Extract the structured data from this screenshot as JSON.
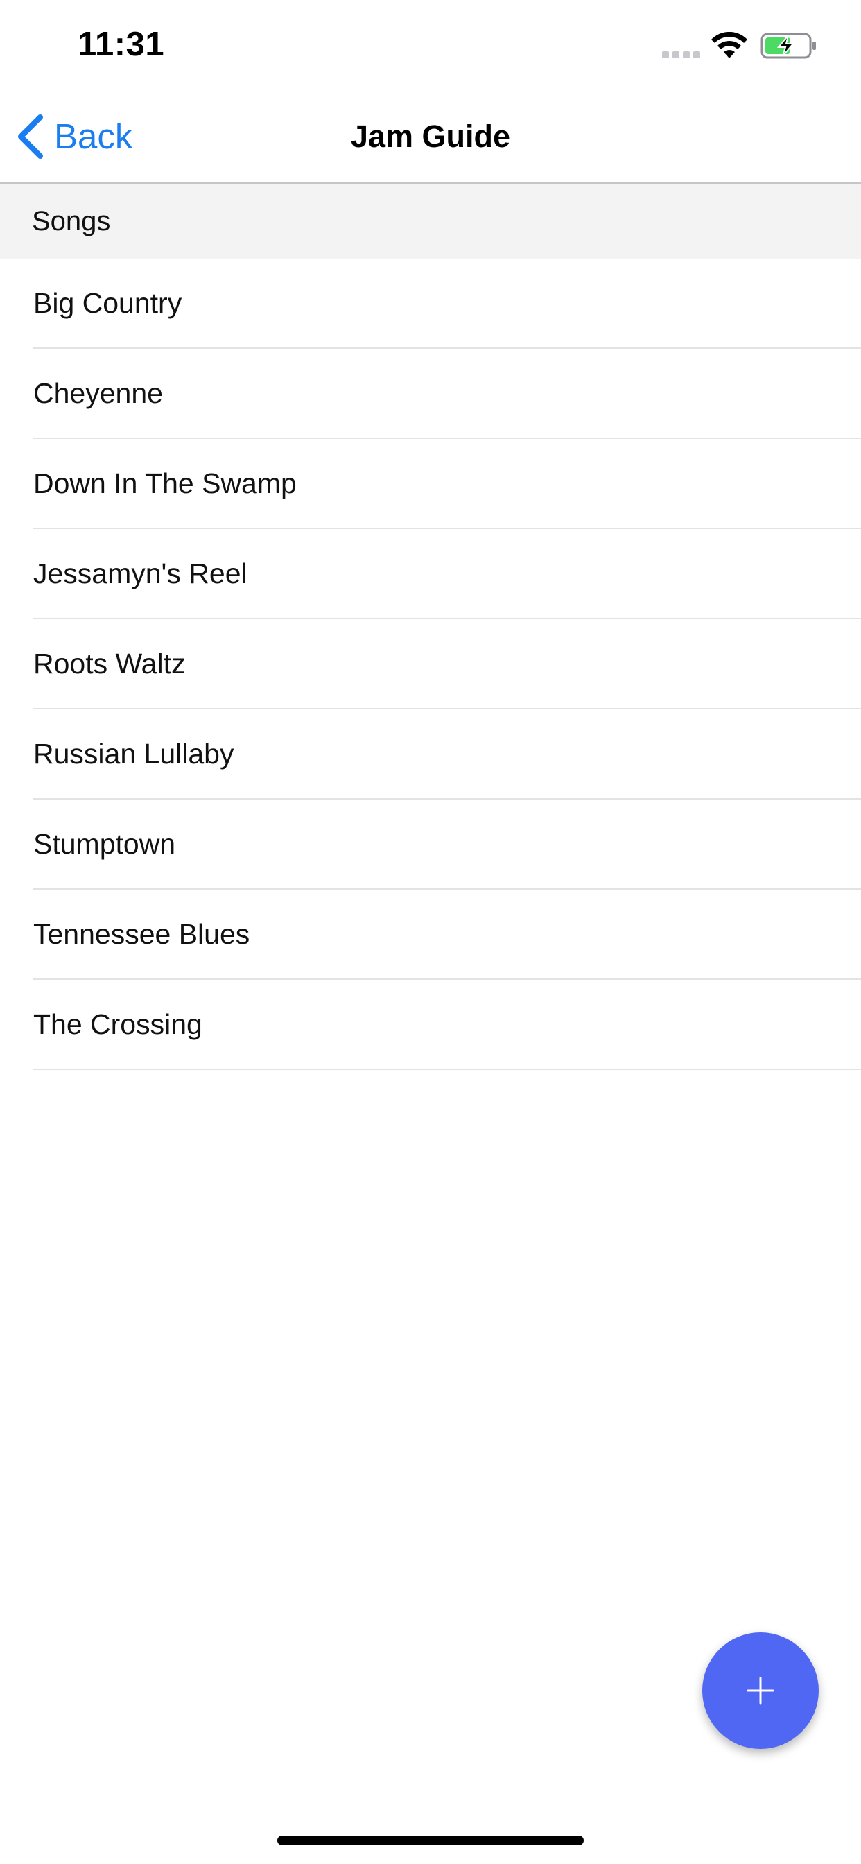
{
  "status_bar": {
    "time": "11:31",
    "icons": [
      "signal-dots-icon",
      "wifi-icon",
      "battery-charging-icon"
    ],
    "battery_color": "#4cd964"
  },
  "nav": {
    "back_label": "Back",
    "title": "Jam Guide",
    "accent_color": "#1a7ef0"
  },
  "section": {
    "header": "Songs"
  },
  "songs": [
    {
      "title": "Big Country"
    },
    {
      "title": "Cheyenne"
    },
    {
      "title": "Down In The Swamp"
    },
    {
      "title": "Jessamyn's Reel"
    },
    {
      "title": "Roots Waltz"
    },
    {
      "title": "Russian Lullaby"
    },
    {
      "title": "Stumptown"
    },
    {
      "title": "Tennessee Blues"
    },
    {
      "title": "The Crossing"
    }
  ],
  "fab": {
    "icon": "plus-icon",
    "color": "#4f67f2"
  }
}
